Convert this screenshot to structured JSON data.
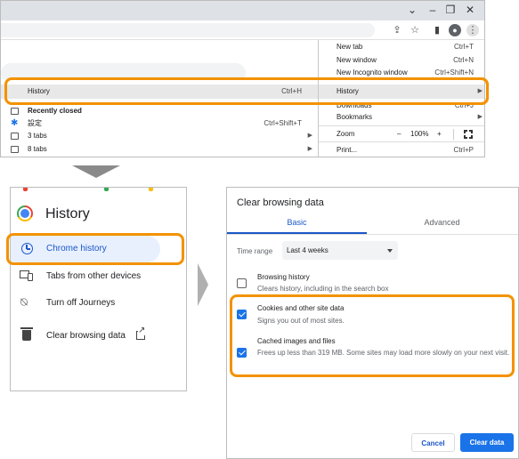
{
  "browser": {
    "menu": {
      "new_tab": {
        "label": "New tab",
        "shortcut": "Ctrl+T"
      },
      "new_window": {
        "label": "New window",
        "shortcut": "Ctrl+N"
      },
      "incognito": {
        "label": "New Incognito window",
        "shortcut": "Ctrl+Shift+N"
      },
      "history": {
        "label": "History"
      },
      "downloads": {
        "label": "Downloads",
        "shortcut": "Ctrl+J"
      },
      "bookmarks": {
        "label": "Bookmarks"
      },
      "zoom": {
        "label": "Zoom",
        "minus": "–",
        "value": "100%",
        "plus": "+"
      },
      "print": {
        "label": "Print...",
        "shortcut": "Ctrl+P"
      }
    },
    "history_submenu": {
      "history": {
        "label": "History",
        "shortcut": "Ctrl+H"
      },
      "recently_closed": "Recently closed",
      "settings": {
        "label": "設定",
        "shortcut": "Ctrl+Shift+T"
      },
      "tabs3": "3 tabs",
      "tabs8": "8 tabs"
    }
  },
  "history_panel": {
    "title": "History",
    "items": [
      {
        "label": "Chrome history"
      },
      {
        "label": "Tabs from other devices"
      },
      {
        "label": "Turn off Journeys"
      },
      {
        "label": "Clear browsing data"
      }
    ]
  },
  "dialog": {
    "title": "Clear browsing data",
    "tabs": {
      "basic": "Basic",
      "advanced": "Advanced"
    },
    "time_range": {
      "label": "Time range",
      "value": "Last 4 weeks"
    },
    "options": [
      {
        "title": "Browsing history",
        "subtitle": "Clears history, including in the search box",
        "checked": false
      },
      {
        "title": "Cookies and other site data",
        "subtitle": "Signs you out of most sites.",
        "checked": true
      },
      {
        "title": "Cached images and files",
        "subtitle": "Frees up less than 319 MB. Some sites may load more slowly on your next visit.",
        "checked": true
      }
    ],
    "buttons": {
      "cancel": "Cancel",
      "clear": "Clear data"
    }
  },
  "colors": {
    "highlight": "#f39200",
    "accent": "#1a73e8",
    "active_bg": "#e8f0fe"
  }
}
